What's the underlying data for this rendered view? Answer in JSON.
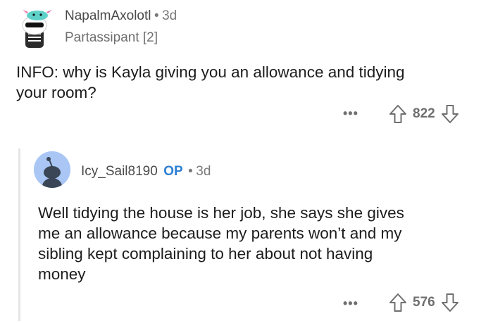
{
  "comment1": {
    "avatar_icon": "axolotl-avatar-icon",
    "username": "NapalmAxolotl",
    "separator": "•",
    "time": "3d",
    "flair": "Partassipant [2]",
    "body": [
      "INFO: why is Kayla giving you an allowance and tidying",
      "your room?"
    ],
    "more_label": "•••",
    "score": "822"
  },
  "comment2": {
    "avatar_icon": "snoo-avatar-icon",
    "username": "Icy_Sail8190",
    "op_badge": "OP",
    "separator": "•",
    "time": "3d",
    "body": [
      "Well tidying the house is her job, she says she gives",
      "me an allowance because my parents won’t and my",
      "sibling kept complaining to her about not having",
      "money"
    ],
    "more_label": "•••",
    "score": "576"
  },
  "colors": {
    "text": "#1c1c1c",
    "meta": "#7a7a7a",
    "op": "#2e7fd3",
    "thread_line": "#e5e5e5",
    "avatar2_bg": "#a9c6f5"
  }
}
